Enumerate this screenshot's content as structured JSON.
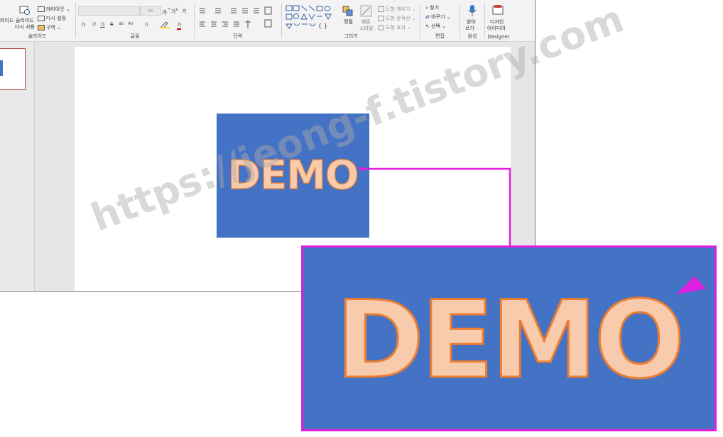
{
  "ribbon": {
    "slides_group": {
      "label": "슬라이드",
      "new_slide_partial": "라이드",
      "reset_slide_line1": "슬라이드",
      "reset_slide_line2": "다시 사용",
      "layout": "레이아웃",
      "reset": "다시 설정",
      "section": "구역"
    },
    "font_group": {
      "label": "글꼴",
      "font_size": "96",
      "grow": "가",
      "shrink": "가",
      "clear": "가",
      "bold": "가",
      "italic": "가",
      "underline": "가",
      "strike": "S",
      "shadow": "ab",
      "spacing": "AV",
      "case": "가",
      "font_color": "가"
    },
    "paragraph_group": {
      "label": "단락"
    },
    "drawing_group": {
      "label": "그리기",
      "arrange": "정렬",
      "quick_styles_line1": "빠른",
      "quick_styles_line2": "스타일",
      "shape_fill": "도형 채우기",
      "shape_outline": "도형 윤곽선",
      "shape_effects": "도형 효과"
    },
    "editing_group": {
      "label": "편집",
      "find": "찾기",
      "replace": "바꾸기",
      "select": "선택"
    },
    "voice_group": {
      "label": "음성",
      "dictate_line1": "받아",
      "dictate_line2": "쓰기"
    },
    "designer_group": {
      "label": "Designer",
      "ideas_line1": "디자인",
      "ideas_line2": "아이디어"
    }
  },
  "slide": {
    "demo_text": "DEMO"
  },
  "zoom": {
    "demo_text": "DEMO"
  },
  "watermark": "https://jeong-f.tistory.com",
  "colors": {
    "shape_fill": "#4472c4",
    "text_fill": "#f8cbad",
    "text_outline": "#ed7d31",
    "callout": "#e020e0"
  }
}
